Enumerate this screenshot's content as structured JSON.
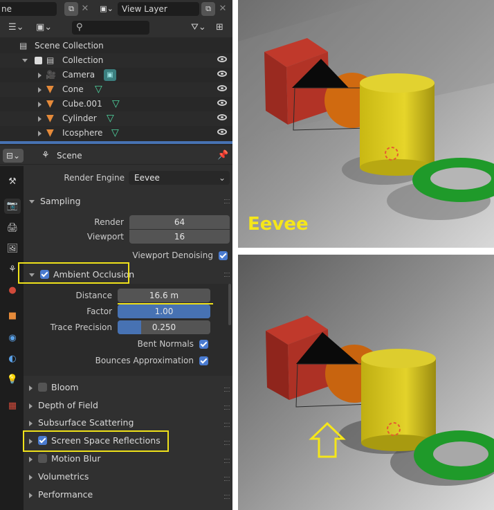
{
  "topbar": {
    "scene_name_fragment": "ne",
    "view_layer": "View Layer"
  },
  "outliner": {
    "search_placeholder": "",
    "scene_collection": "Scene Collection",
    "collection": "Collection",
    "items": [
      {
        "label": "Camera",
        "icon": "camera-icon"
      },
      {
        "label": "Cone",
        "icon": "mesh-icon"
      },
      {
        "label": "Cube.001",
        "icon": "mesh-icon"
      },
      {
        "label": "Cylinder",
        "icon": "mesh-icon"
      },
      {
        "label": "Icosphere",
        "icon": "mesh-icon"
      }
    ]
  },
  "properties": {
    "context": "Scene",
    "render_engine_label": "Render Engine",
    "render_engine_value": "Eevee",
    "sampling": {
      "title": "Sampling",
      "render_label": "Render",
      "render_value": "64",
      "viewport_label": "Viewport",
      "viewport_value": "16",
      "denoise_label": "Viewport Denoising",
      "denoise_checked": true
    },
    "ambient_occlusion": {
      "title": "Ambient Occlusion",
      "enabled": true,
      "distance_label": "Distance",
      "distance_value": "16.6 m",
      "factor_label": "Factor",
      "factor_value": "1.00",
      "factor_fill": 1.0,
      "trace_label": "Trace Precision",
      "trace_value": "0.250",
      "trace_fill": 0.25,
      "bent_normals_label": "Bent Normals",
      "bent_normals_checked": true,
      "bounces_label": "Bounces Approximation",
      "bounces_checked": true
    },
    "panels": [
      {
        "label": "Bloom",
        "checkbox": "off"
      },
      {
        "label": "Depth of Field",
        "checkbox": "none"
      },
      {
        "label": "Subsurface Scattering",
        "checkbox": "none"
      },
      {
        "label": "Screen Space Reflections",
        "checkbox": "on"
      },
      {
        "label": "Motion Blur",
        "checkbox": "off"
      },
      {
        "label": "Volumetrics",
        "checkbox": "none"
      },
      {
        "label": "Performance",
        "checkbox": "none"
      }
    ]
  },
  "viewport_top": {
    "caption": "Eevee"
  },
  "colors": {
    "highlight_yellow": "#f0e21a",
    "blender_blue": "#4772b3",
    "cube_red": "#a52a22",
    "cylinder_yellow": "#d7c81a",
    "torus_green": "#1f9a2a"
  }
}
